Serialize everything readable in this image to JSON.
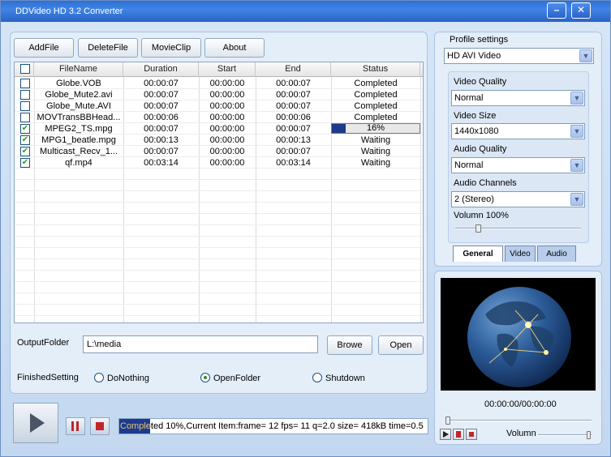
{
  "window": {
    "title": "DDVideo HD 3.2 Converter",
    "minimize_label": "–",
    "close_label": "✕"
  },
  "toolbar": {
    "add_file": "AddFile",
    "delete_file": "DeleteFile",
    "movie_clip": "MovieClip",
    "about": "About"
  },
  "file_table": {
    "columns": [
      "FileName",
      "Duration",
      "Start",
      "End",
      "Status"
    ],
    "rows": [
      {
        "checked": false,
        "name": "Globe.VOB",
        "duration": "00:00:07",
        "start": "00:00:00",
        "end": "00:00:07",
        "status": "Completed"
      },
      {
        "checked": false,
        "name": "Globe_Mute2.avi",
        "duration": "00:00:07",
        "start": "00:00:00",
        "end": "00:00:07",
        "status": "Completed"
      },
      {
        "checked": false,
        "name": "Globe_Mute.AVI",
        "duration": "00:00:07",
        "start": "00:00:00",
        "end": "00:00:07",
        "status": "Completed"
      },
      {
        "checked": false,
        "name": "MOVTransBBHead...",
        "duration": "00:00:06",
        "start": "00:00:00",
        "end": "00:00:06",
        "status": "Completed"
      },
      {
        "checked": true,
        "name": "MPEG2_TS.mpg",
        "duration": "00:00:07",
        "start": "00:00:00",
        "end": "00:00:07",
        "status": "16%",
        "progress": 0.16
      },
      {
        "checked": true,
        "name": "MPG1_beatle.mpg",
        "duration": "00:00:13",
        "start": "00:00:00",
        "end": "00:00:13",
        "status": "Waiting"
      },
      {
        "checked": true,
        "name": "Multicast_Recv_1...",
        "duration": "00:00:07",
        "start": "00:00:00",
        "end": "00:00:07",
        "status": "Waiting"
      },
      {
        "checked": true,
        "name": "qf.mp4",
        "duration": "00:03:14",
        "start": "00:00:00",
        "end": "00:03:14",
        "status": "Waiting"
      }
    ]
  },
  "output": {
    "label": "OutputFolder",
    "path": "L:\\media",
    "browse": "Browe",
    "open": "Open"
  },
  "finished": {
    "label": "FinishedSetting",
    "options": [
      "DoNothing",
      "OpenFolder",
      "Shutdown"
    ],
    "selected": "OpenFolder"
  },
  "profile": {
    "label": "Profile settings",
    "value": "HD AVI Video",
    "video_quality_label": "Video Quality",
    "video_quality": "Normal",
    "video_size_label": "Video Size",
    "video_size": "1440x1080",
    "audio_quality_label": "Audio Quality",
    "audio_quality": "Normal",
    "audio_channels_label": "Audio Channels",
    "audio_channels": "2 (Stereo)",
    "volume_label": "Volumn 100%",
    "volume_level": 1.0,
    "tabs": [
      "General",
      "Video",
      "Audio"
    ],
    "active_tab": "General"
  },
  "preview": {
    "time": "00:00:00/00:00:00",
    "volume_label": "Volumn",
    "seek_position": 0.0,
    "volume_level": 1.0
  },
  "status": {
    "text": "Completed 10%,Current Item:frame=   12 fps= 11 q=2.0 size=      418kB time=0.5",
    "progress": 0.1
  },
  "colors": {
    "accent": "#2e6fd3",
    "progress": "#1d3a8c",
    "check": "#21a121"
  }
}
